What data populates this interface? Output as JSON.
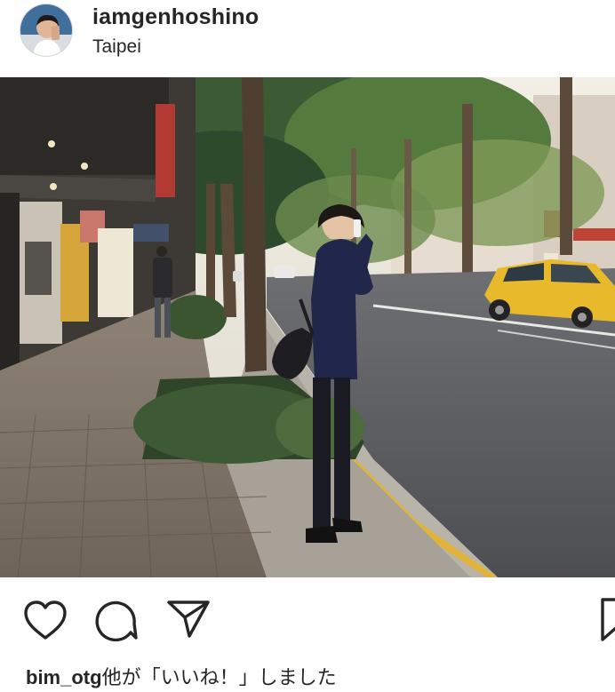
{
  "post": {
    "username": "iamgenhoshino",
    "location": "Taipei"
  },
  "actions": {
    "like": "heart-icon",
    "comment": "comment-icon",
    "share": "send-icon",
    "save": "bookmark-icon"
  },
  "likes": {
    "user": "bim_otg",
    "suffix": "他が「いいね！」しました"
  },
  "colors": {
    "text": "#262626",
    "background": "#ffffff",
    "taxi_yellow": "#e8b92a",
    "curb_yellow": "#e0b43a"
  }
}
